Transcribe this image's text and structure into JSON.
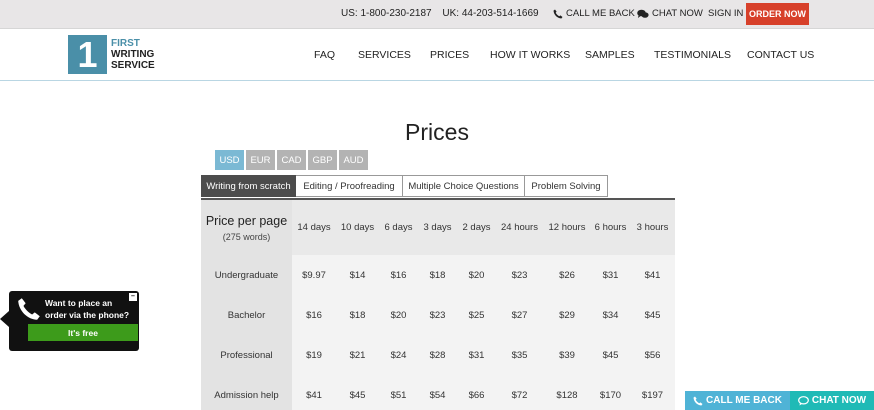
{
  "topbar": {
    "phone_us": "US: 1-800-230-2187",
    "phone_uk": "UK: 44-203-514-1669",
    "call_me_back": "CALL ME BACK",
    "chat_now": "CHAT NOW",
    "sign_in": "SIGN IN",
    "order_now": "ORDER NOW"
  },
  "logo": {
    "number": "1",
    "line1": "FIRST",
    "line2": "WRITING",
    "line3": "SERVICE"
  },
  "nav": {
    "faq": "FAQ",
    "services": "SERVICES",
    "prices": "PRICES",
    "how_it_works": "HOW IT WORKS",
    "samples": "SAMPLES",
    "testimonials": "TESTIMONIALS",
    "contact_us": "CONTACT US"
  },
  "page_title": "Prices",
  "currencies": {
    "usd": "USD",
    "eur": "EUR",
    "cad": "CAD",
    "gbp": "GBP",
    "aud": "AUD",
    "selected": "USD"
  },
  "service_tabs": {
    "writing": "Writing from scratch",
    "editing": "Editing / Proofreading",
    "mcq": "Multiple Choice Questions",
    "problem": "Problem Solving",
    "selected": "Writing from scratch"
  },
  "price_table": {
    "header_label": "Price per page",
    "header_sub": "(275 words)",
    "deadlines": [
      "14 days",
      "10 days",
      "6 days",
      "3 days",
      "2 days",
      "24 hours",
      "12 hours",
      "6 hours",
      "3 hours"
    ],
    "rows": [
      {
        "level": "Undergraduate",
        "prices": [
          "$9.97",
          "$14",
          "$16",
          "$18",
          "$20",
          "$23",
          "$26",
          "$31",
          "$41"
        ]
      },
      {
        "level": "Bachelor",
        "prices": [
          "$16",
          "$18",
          "$20",
          "$23",
          "$25",
          "$27",
          "$29",
          "$34",
          "$45"
        ]
      },
      {
        "level": "Professional",
        "prices": [
          "$19",
          "$21",
          "$24",
          "$28",
          "$31",
          "$35",
          "$39",
          "$45",
          "$56"
        ]
      },
      {
        "level": "Admission help",
        "prices": [
          "$41",
          "$45",
          "$51",
          "$54",
          "$66",
          "$72",
          "$128",
          "$170",
          "$197"
        ]
      }
    ]
  },
  "phone_popup": {
    "text": "Want to place an order via the phone?",
    "button": "It's free",
    "close": "–"
  },
  "bottom_bar": {
    "call_me_back": "CALL ME BACK",
    "chat_now": "CHAT NOW"
  },
  "colors": {
    "accent_blue": "#4a8fa8",
    "order_red": "#d7402a",
    "currency_active": "#7bb9d4",
    "free_green": "#3d9b1b",
    "call_blue": "#4fb3d6",
    "chat_teal": "#1fbab6"
  }
}
